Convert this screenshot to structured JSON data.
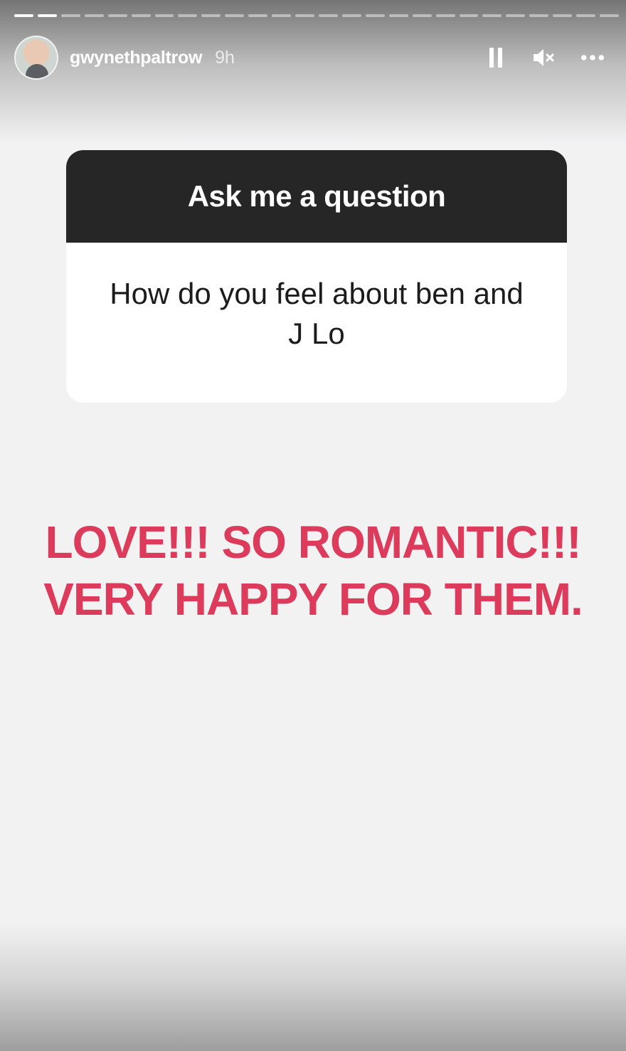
{
  "story": {
    "progress": {
      "total_segments": 26,
      "completed_segments": 2
    },
    "user": {
      "username": "gwynethpaltrow",
      "time_ago": "9h"
    },
    "controls": {
      "pause_icon": "pause-icon",
      "mute_icon": "muted-speaker-icon",
      "more_icon": "more-options-icon"
    }
  },
  "question_sticker": {
    "header": "Ask me a question",
    "question": "How do you feel about ben and J Lo"
  },
  "answer": {
    "line1": "LOVE!!! SO ROMANTIC!!!",
    "line2": "VERY HAPPY FOR THEM.",
    "color": "#dc3b5c"
  }
}
